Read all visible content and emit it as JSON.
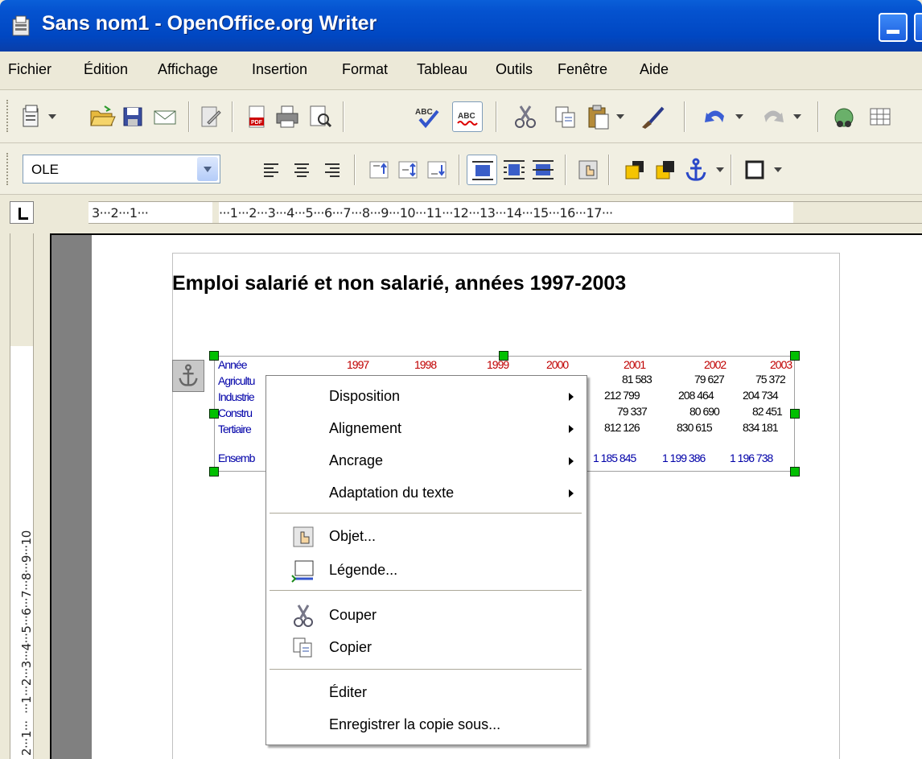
{
  "window": {
    "title": "Sans nom1 - OpenOffice.org Writer"
  },
  "menubar": {
    "items": [
      "Fichier",
      "Édition",
      "Affichage",
      "Insertion",
      "Format",
      "Tableau",
      "Outils",
      "Fenêtre",
      "Aide"
    ]
  },
  "toolbar_frame": {
    "combo_value": "OLE"
  },
  "ruler": {
    "left_text": "3···2···1···",
    "right_text": "···1···2···3···4···5···6···7···8···9···10···11···12···13···14···15···16···17···",
    "vertical_text": "2···1···  ···1···2···3···4···5···6···7···8···9···10"
  },
  "document": {
    "heading": "Emploi salarié et non salarié, années 1997-2003",
    "ole_table": {
      "header_label": "Année",
      "years": [
        "1997",
        "1998",
        "1999",
        "2000",
        "2001",
        "2002",
        "2003"
      ],
      "row_labels": [
        "Agricultu",
        "Industrie",
        "Constru",
        "Tertiaire",
        "Ensemb"
      ],
      "col_2001": [
        "81 583",
        "212 799",
        "79 337",
        "812 126",
        "1 185 845"
      ],
      "col_2002": [
        "79 627",
        "208 464",
        "80 690",
        "830 615",
        "1 199 386"
      ],
      "col_2003": [
        "75 372",
        "204 734",
        "82 451",
        "834 181",
        "1 196 738"
      ]
    }
  },
  "context_menu": {
    "disposition": "Disposition",
    "alignement": "Alignement",
    "ancrage": "Ancrage",
    "adaptation": "Adaptation du texte",
    "objet": "Objet...",
    "legende": "Légende...",
    "couper": "Couper",
    "copier": "Copier",
    "editer": "Éditer",
    "enregistrer": "Enregistrer la copie sous..."
  },
  "colors": {
    "titlebar": "#0553d0",
    "year_red": "#c00000",
    "label_blue": "#0000a8",
    "handle_green": "#00c000"
  }
}
